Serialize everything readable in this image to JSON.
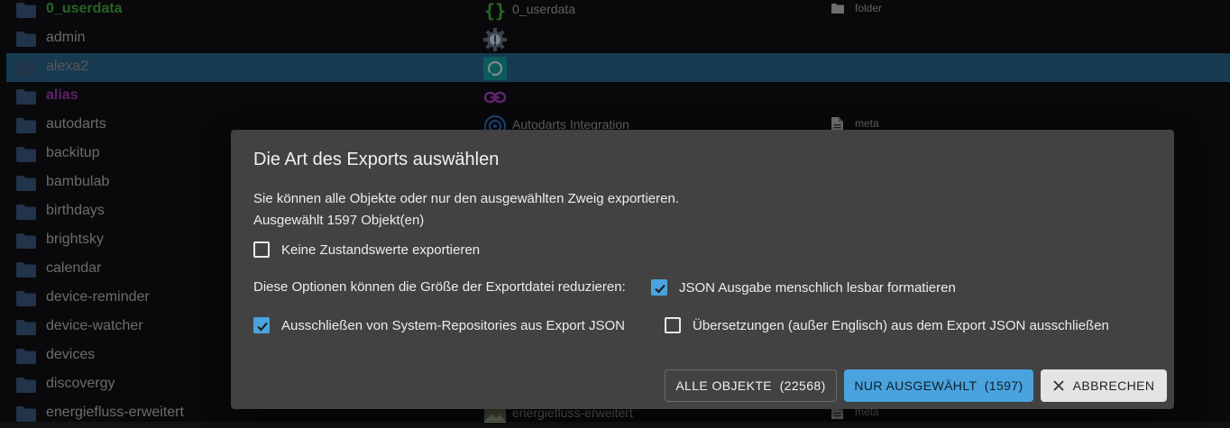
{
  "tree": {
    "rows": [
      {
        "name": "0_userdata",
        "style": "green",
        "obj_name": "0_userdata",
        "obj_icon": "curly-braces-icon",
        "type": "folder",
        "selected": false
      },
      {
        "name": "admin",
        "style": "normal",
        "obj_name": "",
        "obj_icon": "gear-icon",
        "type": "",
        "selected": false
      },
      {
        "name": "alexa2",
        "style": "dim",
        "obj_name": "",
        "obj_icon": "alexa-icon",
        "type": "",
        "selected": true
      },
      {
        "name": "alias",
        "style": "purple",
        "obj_name": "",
        "obj_icon": "link-icon",
        "type": "",
        "selected": false
      },
      {
        "name": "autodarts",
        "style": "normal",
        "obj_name": "Autodarts Integration",
        "obj_icon": "target-icon",
        "type": "meta",
        "selected": false
      },
      {
        "name": "backitup",
        "style": "normal",
        "obj_name": "",
        "obj_icon": "",
        "type": "",
        "selected": false
      },
      {
        "name": "bambulab",
        "style": "normal",
        "obj_name": "",
        "obj_icon": "",
        "type": "",
        "selected": false
      },
      {
        "name": "birthdays",
        "style": "normal",
        "obj_name": "",
        "obj_icon": "",
        "type": "",
        "selected": false
      },
      {
        "name": "brightsky",
        "style": "normal",
        "obj_name": "",
        "obj_icon": "",
        "type": "",
        "selected": false
      },
      {
        "name": "calendar",
        "style": "normal",
        "obj_name": "",
        "obj_icon": "",
        "type": "",
        "selected": false
      },
      {
        "name": "device-reminder",
        "style": "normal",
        "obj_name": "",
        "obj_icon": "",
        "type": "",
        "selected": false
      },
      {
        "name": "device-watcher",
        "style": "normal",
        "obj_name": "",
        "obj_icon": "",
        "type": "",
        "selected": false
      },
      {
        "name": "devices",
        "style": "normal",
        "obj_name": "",
        "obj_icon": "",
        "type": "",
        "selected": false
      },
      {
        "name": "discovergy",
        "style": "normal",
        "obj_name": "",
        "obj_icon": "",
        "type": "",
        "selected": false
      },
      {
        "name": "energiefluss-erweitert",
        "style": "normal",
        "obj_name": "energiefluss-erweitert",
        "obj_icon": "image-icon",
        "type": "meta",
        "selected": false
      }
    ]
  },
  "dialog": {
    "title": "Die Art des Exports auswählen",
    "description": "Sie können alle Objekte oder nur den ausgewählten Zweig exportieren.",
    "selected_count_text": "Ausgewählt 1597 Objekt(en)",
    "no_state_values": {
      "label": "Keine Zustandswerte exportieren",
      "checked": false
    },
    "options_label": "Diese Optionen können die Größe der Exportdatei reduzieren:",
    "json_readable": {
      "label": "JSON Ausgabe menschlich lesbar formatieren",
      "checked": true
    },
    "exclude_system_repos": {
      "label": "Ausschließen von System-Repositories aus Export JSON",
      "checked": true
    },
    "exclude_translations": {
      "label": "Übersetzungen (außer Englisch) aus dem Export JSON ausschließen",
      "checked": false
    },
    "buttons": {
      "all": "ALLE OBJEKTE  (22568)",
      "selected": "NUR AUSGEWÄHLT  (1597)",
      "cancel": "ABBRECHEN"
    }
  },
  "colors": {
    "accent": "#4aa3df",
    "selected_row": "#2b6a92",
    "folder": "#3d5f86",
    "dialog_bg": "#424242"
  }
}
